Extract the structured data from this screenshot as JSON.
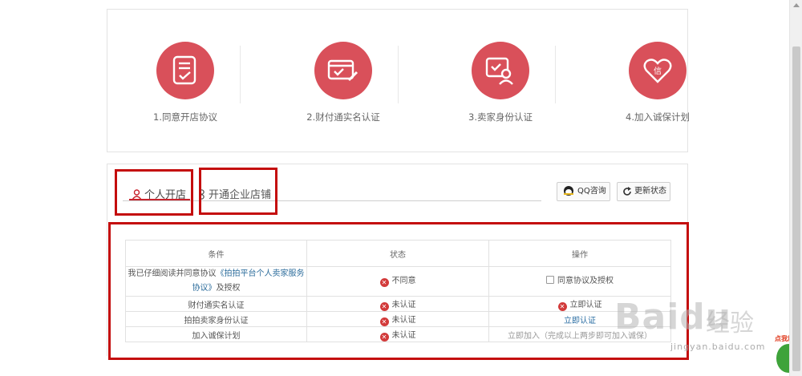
{
  "steps": [
    {
      "label": "1.同意开店协议",
      "icon": "agreement-doc-icon"
    },
    {
      "label": "2.财付通实名认证",
      "icon": "card-verify-icon"
    },
    {
      "label": "3.卖家身份认证",
      "icon": "seller-identity-icon"
    },
    {
      "label": "4.加入诚保计划",
      "icon": "heart-credit-icon"
    }
  ],
  "tabs": {
    "personal": "个人开店",
    "company": "开通企业店铺"
  },
  "buttons": {
    "qq": "QQ咨询",
    "refresh": "更新状态"
  },
  "table": {
    "headers": [
      "条件",
      "状态",
      "操作"
    ],
    "rows": [
      {
        "cond_prefix": "我已仔细阅读并同意协议",
        "cond_link": "《拍拍平台个人卖家服务协议》",
        "cond_suffix": "及授权",
        "status": "不同意",
        "action": "同意协议及授权"
      },
      {
        "cond": "财付通实名认证",
        "status": "未认证",
        "action": "立即认证"
      },
      {
        "cond": "拍拍卖家身份认证",
        "status": "未认证",
        "action": "立即认证"
      },
      {
        "cond": "加入诚保计划",
        "status": "未认证",
        "action": "立即加入（完成以上两步即可加入诚保）"
      }
    ]
  },
  "watermark": {
    "brand": "Baidu",
    "cn": "经验",
    "url": "jingyan.baidu.com",
    "badge": "点我加速"
  },
  "colors": {
    "step_circle": "#d9505a",
    "annotation_red": "#c40d0d",
    "status_x": "#d23a3a",
    "link_blue": "#2d6d9c"
  }
}
